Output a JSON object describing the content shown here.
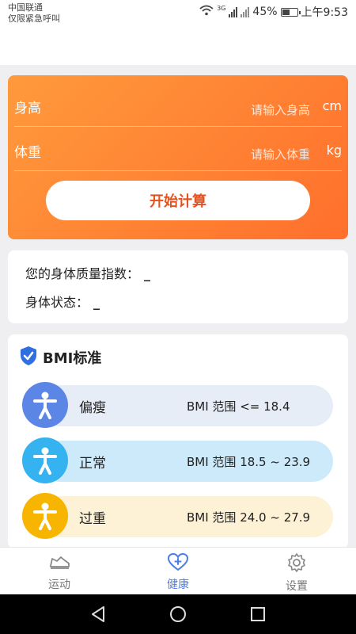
{
  "status_bar": {
    "carrier": "中国联通",
    "emergency": "仅限紧急呼叫",
    "network": "3G",
    "battery": "45%",
    "time": "上午9:53"
  },
  "calculator": {
    "height_label": "身高",
    "height_placeholder": "请输入身高",
    "height_unit": "cm",
    "weight_label": "体重",
    "weight_placeholder": "请输入体重",
    "weight_unit": "kg",
    "start_button": "开始计算"
  },
  "result": {
    "bmi_label": "您的身体质量指数：",
    "bmi_value": "_",
    "state_label": "身体状态：",
    "state_value": "_"
  },
  "bmi_standard": {
    "title": "BMI标准",
    "rows": [
      {
        "name": "偏瘦",
        "range": "BMI 范围 <= 18.4",
        "circle_color": "#5b86e5",
        "bar_color": "#e6edf7"
      },
      {
        "name": "正常",
        "range": "BMI 范围 18.5 ~ 23.9",
        "circle_color": "#35b3f0",
        "bar_color": "#cdeafb"
      },
      {
        "name": "过重",
        "range": "BMI 范围 24.0 ~ 27.9",
        "circle_color": "#f7b500",
        "bar_color": "#fdf1d6"
      }
    ]
  },
  "bottom_nav": {
    "items": [
      {
        "label": "运动",
        "icon": "shoe-icon",
        "active": false
      },
      {
        "label": "健康",
        "icon": "heart-plus-icon",
        "active": true
      },
      {
        "label": "设置",
        "icon": "gear-icon",
        "active": false
      }
    ]
  },
  "colors": {
    "accent": "#4a7ee6",
    "orange_start": "#ff9a3c",
    "orange_end": "#ff6f2c",
    "button_text": "#e4521f"
  }
}
